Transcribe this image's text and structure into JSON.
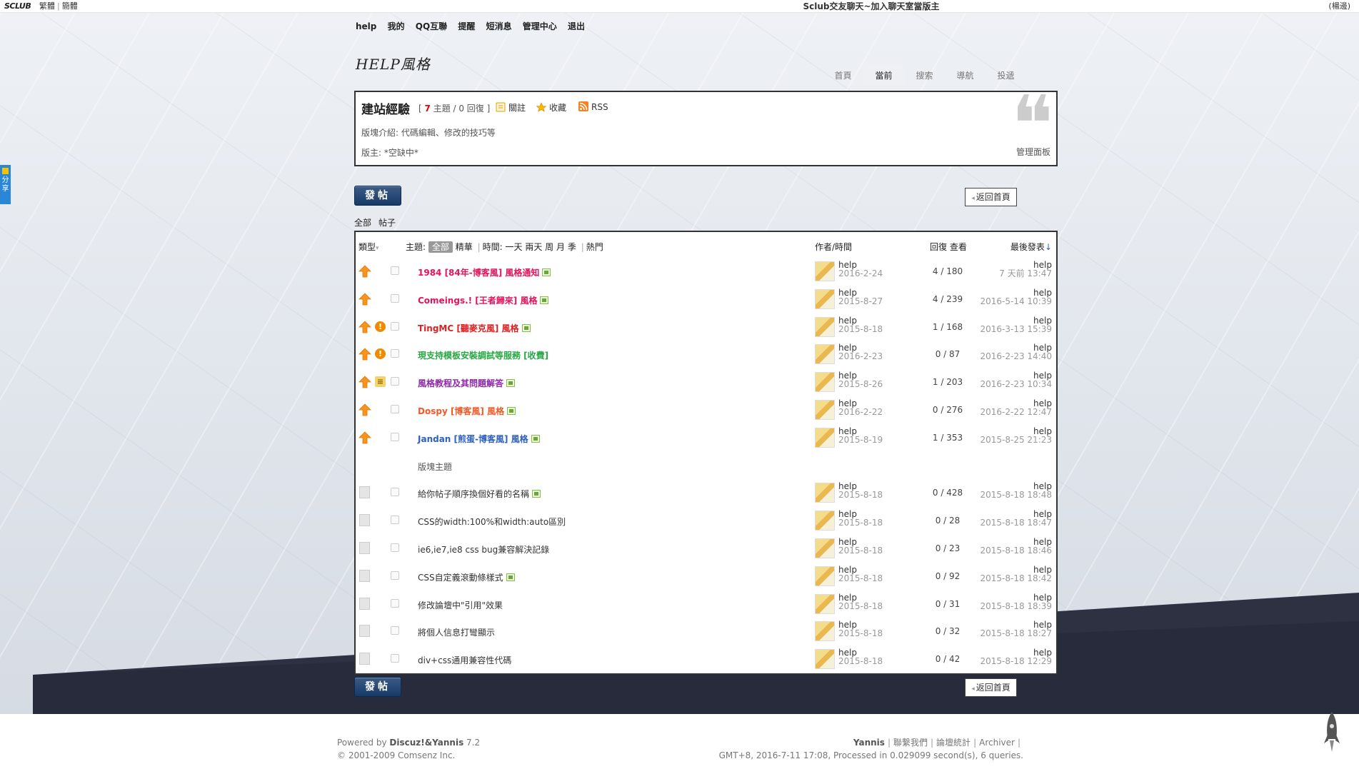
{
  "topbar": {
    "logo": "SCLUB",
    "lang_trad": "繁體",
    "lang_simp": "簡體",
    "site_title": "Sclub交友聊天~加入聊天室當版主",
    "right": "(楊邊)"
  },
  "usernav": [
    "help",
    "我的",
    "QQ互聯",
    "提醒",
    "短消息",
    "管理中心",
    "退出"
  ],
  "forum_logo": "HELP風格",
  "mainnav": [
    "首頁",
    "當前",
    "搜索",
    "導航",
    "投遞"
  ],
  "forum": {
    "name": "建站經驗",
    "threads": "7",
    "stats_rest": "主題 / 0 回復",
    "follow": "關註",
    "favorite": "收藏",
    "rss": "RSS",
    "desc": "版塊介紹: 代碼編輯、修改的技巧等",
    "moderator": "版主: *空缺中*",
    "panel": "管理面板"
  },
  "buttons": {
    "post": "發帖",
    "back": "返回首頁"
  },
  "subtabs": [
    "全部",
    "帖子"
  ],
  "thead": {
    "type": "類型",
    "topic": "主題:",
    "all": "全部",
    "digest": "精華",
    "time": "時間:",
    "day": "一天",
    "twodays": "兩天",
    "week": "周",
    "month": "月",
    "season": "季",
    "hot": "熱門",
    "author": "作者/時間",
    "replies": "回復 查看",
    "lastpost": "最後發表"
  },
  "colors": {
    "accent": "#173a66",
    "title_red": "#e5135c",
    "title_red2": "#e02020",
    "title_green": "#28a745",
    "title_purple": "#8e28a8",
    "title_orange": "#f05a28",
    "title_blue": "#2c5fbf"
  },
  "threads": [
    {
      "title": "1984 [84年-博客風] 風格通知",
      "color": "#e5135c",
      "flag": "",
      "img": true,
      "author": "help",
      "date": "2016-2-24",
      "counts": "4 / 180",
      "last_name": "help",
      "last_date": "7 天前 13:47"
    },
    {
      "title": "Comeings.! [王者歸來] 風格",
      "color": "#e5135c",
      "flag": "",
      "img": true,
      "author": "help",
      "date": "2015-8-27",
      "counts": "4 / 239",
      "last_name": "help",
      "last_date": "2016-5-14 10:39"
    },
    {
      "title": "TingMC [聽麥克風] 風格",
      "color": "#e02020",
      "flag": "!",
      "img": true,
      "author": "help",
      "date": "2015-8-18",
      "counts": "1 / 168",
      "last_name": "help",
      "last_date": "2016-3-13 15:39"
    },
    {
      "title": "現支持模板安裝調試等服務 [收費]",
      "color": "#28a745",
      "flag": "!",
      "img": false,
      "author": "help",
      "date": "2016-2-23",
      "counts": "0 / 87",
      "last_name": "help",
      "last_date": "2016-2-23 14:40"
    },
    {
      "title": "風格教程及其問題解答",
      "color": "#8e28a8",
      "flag": "S",
      "img": true,
      "author": "help",
      "date": "2015-8-26",
      "counts": "1 / 203",
      "last_name": "help",
      "last_date": "2016-2-23 10:34"
    },
    {
      "title": "Dospy [博客風] 風格",
      "color": "#f05a28",
      "flag": "",
      "img": true,
      "author": "help",
      "date": "2016-2-22",
      "counts": "0 / 276",
      "last_name": "help",
      "last_date": "2016-2-22 12:47"
    },
    {
      "title": "Jandan [煎蛋-博客風] 風格",
      "color": "#2c5fbf",
      "flag": "",
      "img": true,
      "author": "help",
      "date": "2015-8-19",
      "counts": "1 / 353",
      "last_name": "help",
      "last_date": "2015-8-25 21:23"
    }
  ],
  "section_label": "版塊主題",
  "normal_threads": [
    {
      "title": "給你帖子順序換個好看的名稱",
      "img": true,
      "author": "help",
      "date": "2015-8-18",
      "counts": "0 / 428",
      "last_name": "help",
      "last_date": "2015-8-18 18:48"
    },
    {
      "title": "CSS的width:100%和width:auto區別",
      "img": false,
      "author": "help",
      "date": "2015-8-18",
      "counts": "0 / 28",
      "last_name": "help",
      "last_date": "2015-8-18 18:47"
    },
    {
      "title": "ie6,ie7,ie8 css bug兼容解決記錄",
      "img": false,
      "author": "help",
      "date": "2015-8-18",
      "counts": "0 / 23",
      "last_name": "help",
      "last_date": "2015-8-18 18:46"
    },
    {
      "title": "CSS自定義滾動條樣式",
      "img": true,
      "author": "help",
      "date": "2015-8-18",
      "counts": "0 / 92",
      "last_name": "help",
      "last_date": "2015-8-18 18:42"
    },
    {
      "title": "修改論壇中\"引用\"效果",
      "img": false,
      "author": "help",
      "date": "2015-8-18",
      "counts": "0 / 31",
      "last_name": "help",
      "last_date": "2015-8-18 18:39"
    },
    {
      "title": "將個人信息打彎顯示",
      "img": false,
      "author": "help",
      "date": "2015-8-18",
      "counts": "0 / 32",
      "last_name": "help",
      "last_date": "2015-8-18 18:27"
    },
    {
      "title": "div+css通用兼容性代碼",
      "img": false,
      "author": "help",
      "date": "2015-8-18",
      "counts": "0 / 42",
      "last_name": "help",
      "last_date": "2015-8-18 12:29"
    }
  ],
  "footer": {
    "powered": "Powered by",
    "product": "Discuz!&Yannis",
    "version": "7.2",
    "copyright": "© 2001-2009 Comsenz Inc.",
    "links": [
      "Yannis",
      "聯繫我們",
      "論壇統計",
      "Archiver"
    ],
    "stats": "GMT+8, 2016-7-11 17:08, Processed in 0.029099 second(s), 6 queries."
  },
  "share_tab": "分享"
}
